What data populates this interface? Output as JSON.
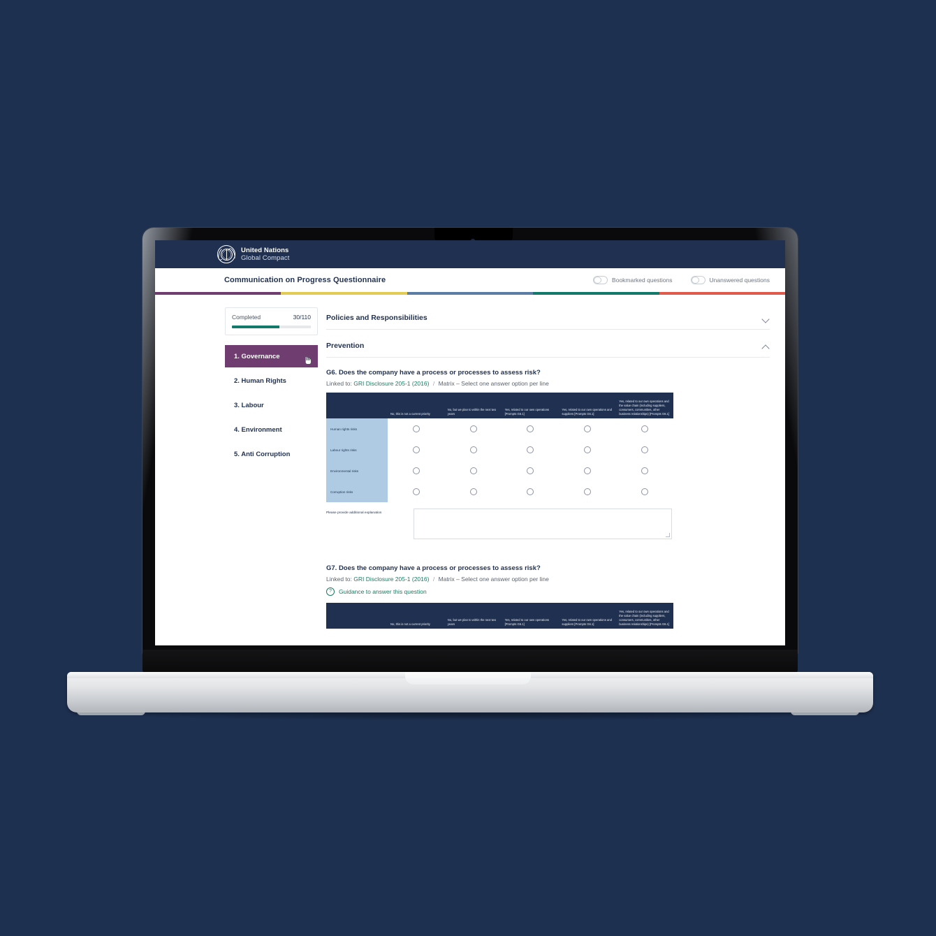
{
  "background_color": "#1d3050",
  "brand": {
    "line1": "United Nations",
    "line2": "Global Compact",
    "emblem_icon": "un-emblem-icon",
    "header_bg": "#1f3050"
  },
  "header": {
    "app_title": "Communication on Progress Questionnaire",
    "toggles": [
      {
        "label": "Bookmarked questions",
        "on": false
      },
      {
        "label": "Unanswered questions",
        "on": false
      }
    ],
    "stripe_colors": [
      "#6f3d70",
      "#e3cc55",
      "#5b7ca3",
      "#12796b",
      "#e05b4b"
    ]
  },
  "sidebar": {
    "progress": {
      "label": "Completed",
      "value": "30/110",
      "percent": 60,
      "fill_color": "#12796b"
    },
    "items": [
      {
        "label": "1. Governance",
        "active": true
      },
      {
        "label": "2. Human Rights",
        "active": false
      },
      {
        "label": "3. Labour",
        "active": false
      },
      {
        "label": "4. Environment",
        "active": false
      },
      {
        "label": "5. Anti Corruption",
        "active": false
      }
    ],
    "active_color": "#6f3d70",
    "cursor_icon": "hand-pointer-cursor"
  },
  "main": {
    "sections": [
      {
        "title": "Policies and Responsibilities",
        "expanded": false,
        "chevron_icon": "chevron-down-icon"
      },
      {
        "title": "Prevention",
        "expanded": true,
        "chevron_icon": "chevron-up-icon"
      }
    ],
    "questions": [
      {
        "id": "G6",
        "title": "G6. Does the company have a process or processes to assess risk?",
        "linked_prefix": "Linked to:",
        "linked_label": "GRI Disclosure 205-1 (2016)",
        "separator": "/",
        "type_label": "Matrix – Select one answer option per line",
        "has_guidance": false,
        "matrix": {
          "columns": [
            "No, this is not a current priority",
            "No, but we plan to within the next two years",
            "Yes, related to our own operations [Prompts G6.1]",
            "Yes, related to our own operations and suppliers [Prompts G6.1]",
            "Yes, related to our own operations and the value chain (including suppliers, consumers, communities, other business relationships) [Prompts G6.1]"
          ],
          "rows": [
            "Human rights risks",
            "Labour rights risks",
            "Environmental risks",
            "Corruption risks"
          ],
          "header_bg": "#1f3050",
          "rowlabel_bg": "#aecbe3"
        },
        "explanation_label": "Please provide additional explanation",
        "explanation_value": ""
      },
      {
        "id": "G7",
        "title": "G7. Does the company have a process or processes to assess risk?",
        "linked_prefix": "Linked to:",
        "linked_label": "GRI Disclosure 205-1 (2016)",
        "separator": "/",
        "type_label": "Matrix – Select one answer option per line",
        "has_guidance": true,
        "guidance_label": "Guidance to answer this question",
        "guidance_icon": "question-mark-circle-icon",
        "matrix": {
          "columns": [
            "No, this is not a current priority",
            "No, but we plan to within the next two years",
            "Yes, related to our own operations [Prompts G6.1]",
            "Yes, related to our own operations and suppliers [Prompts G6.1]",
            "Yes, related to our own operations and the value chain (including suppliers, consumers, communities, other business relationships) [Prompts G6.1]"
          ],
          "rows": [],
          "header_bg": "#1f3050",
          "rowlabel_bg": "#aecbe3"
        }
      }
    ]
  }
}
